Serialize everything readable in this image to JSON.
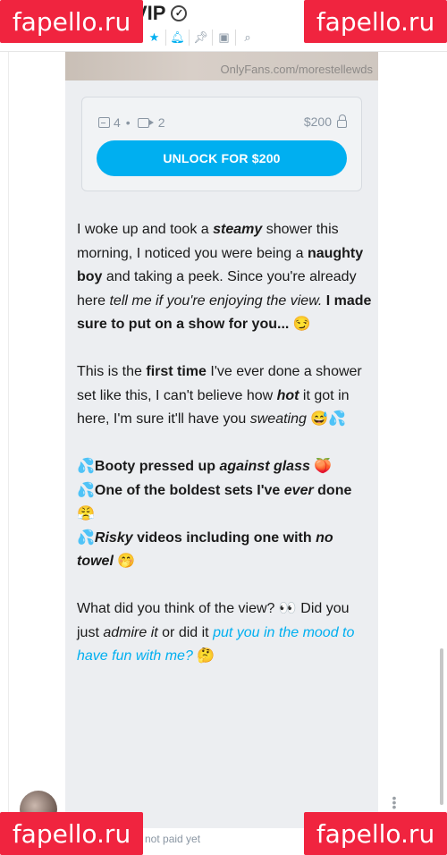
{
  "header": {
    "title_fragment": "VIP",
    "tools": [
      "star-icon",
      "bell-icon",
      "pin-icon",
      "image-icon",
      "search-icon"
    ]
  },
  "post": {
    "watermark": "OnlyFans.com/morestellewds",
    "locked": {
      "image_count": "4",
      "video_count": "2",
      "price": "$200",
      "unlock_label": "UNLOCK FOR $200"
    },
    "paragraphs": [
      [
        {
          "t": "I woke up and took a "
        },
        {
          "t": "steamy",
          "b": true,
          "i": true
        },
        {
          "t": " shower this morning, I noticed you were being a "
        },
        {
          "t": "naughty boy",
          "b": true
        },
        {
          "t": " and taking a peek. Since you're already here "
        },
        {
          "t": "tell me if you're enjoying the view.",
          "i": true
        },
        {
          "t": " "
        },
        {
          "t": "I made sure to put on a show for you...",
          "b": true
        },
        {
          "t": " 😏"
        }
      ],
      [
        {
          "t": "This is the "
        },
        {
          "t": "first time",
          "b": true
        },
        {
          "t": " I've ever done a shower set like this, I can't believe how "
        },
        {
          "t": "hot",
          "b": true,
          "i": true
        },
        {
          "t": " it got in here, I'm sure it'll have you "
        },
        {
          "t": "sweating",
          "i": true
        },
        {
          "t": " 😅💦"
        }
      ],
      [
        {
          "t": "💦Booty pressed up ",
          "b": true
        },
        {
          "t": "against glass",
          "b": true,
          "i": true
        },
        {
          "t": " 🍑",
          "b": true
        },
        {
          "br": true
        },
        {
          "t": "💦One of the boldest sets I've ",
          "b": true
        },
        {
          "t": "ever",
          "b": true,
          "i": true
        },
        {
          "t": " done 😤",
          "b": true
        },
        {
          "br": true
        },
        {
          "t": "💦",
          "b": true
        },
        {
          "t": "Risky",
          "b": true,
          "i": true
        },
        {
          "t": " videos including one with ",
          "b": true
        },
        {
          "t": "no towel",
          "b": true,
          "i": true
        },
        {
          "t": " 🤭"
        }
      ],
      [
        {
          "t": "What did you think of the view? 👀 Did you just "
        },
        {
          "t": "admire it",
          "i": true
        },
        {
          "t": " or did it "
        },
        {
          "t": "put you in the mood to have fun with me?",
          "link": true
        },
        {
          "t": " 🤔"
        }
      ]
    ]
  },
  "footer": {
    "paid_status": "not paid yet"
  },
  "overlay": {
    "watermark_text": "fapello.ru"
  },
  "colors": {
    "accent": "#00aff0",
    "overlay_red": "#f0243f",
    "card_bg": "#eceef1",
    "muted": "#8a96a3"
  }
}
